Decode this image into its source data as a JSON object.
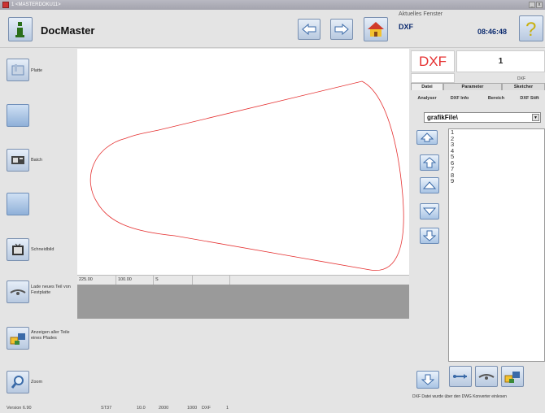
{
  "window": {
    "title": "1 <MASTERDOKU11>"
  },
  "app": {
    "name": "DocMaster"
  },
  "current_window": {
    "label": "Aktuelles Fenster",
    "value": "DXF"
  },
  "clock": "08:46:48",
  "sidebar": {
    "items": [
      {
        "label": "Platte",
        "icon": "plate-icon"
      },
      {
        "label": "",
        "icon": "blank-button"
      },
      {
        "label": "Batch",
        "icon": "batch-icon"
      },
      {
        "label": "",
        "icon": "blank-button"
      },
      {
        "label": "Schneidbild",
        "icon": "cutting-icon"
      },
      {
        "label": "Lade neues Teil von Festplatte",
        "icon": "load-disk-icon"
      },
      {
        "label": "Anzeigen aller Teile eines Pfades",
        "icon": "folder-parts-icon"
      },
      {
        "label": "Zoom",
        "icon": "zoom-icon"
      }
    ]
  },
  "status_grid": [
    "225.00",
    "100.00",
    "S",
    "",
    ""
  ],
  "right_panel": {
    "dxf_label": "DXF",
    "page_number": "1",
    "mini_label": "DXF",
    "tabs": [
      "Datei",
      "Parameter",
      "Sketcher"
    ],
    "subtabs": [
      "Analyser",
      "DXF Info",
      "Bereich",
      "DXF Stift"
    ],
    "folder": "grafikFile\\",
    "files": [
      "1",
      "2",
      "3",
      "4",
      "5",
      "6",
      "7",
      "8",
      "9"
    ],
    "status_message": "DXF Datei wurde über den DWG Konverter einlesen"
  },
  "footer": {
    "version": "Version 6.90",
    "items": [
      "ST37",
      "10.0",
      "2000",
      "1000",
      "DXF",
      "1"
    ]
  },
  "colors": {
    "shape_outline": "#e53030",
    "dxf_text": "#e53030",
    "accent": "#0b2a6e"
  }
}
